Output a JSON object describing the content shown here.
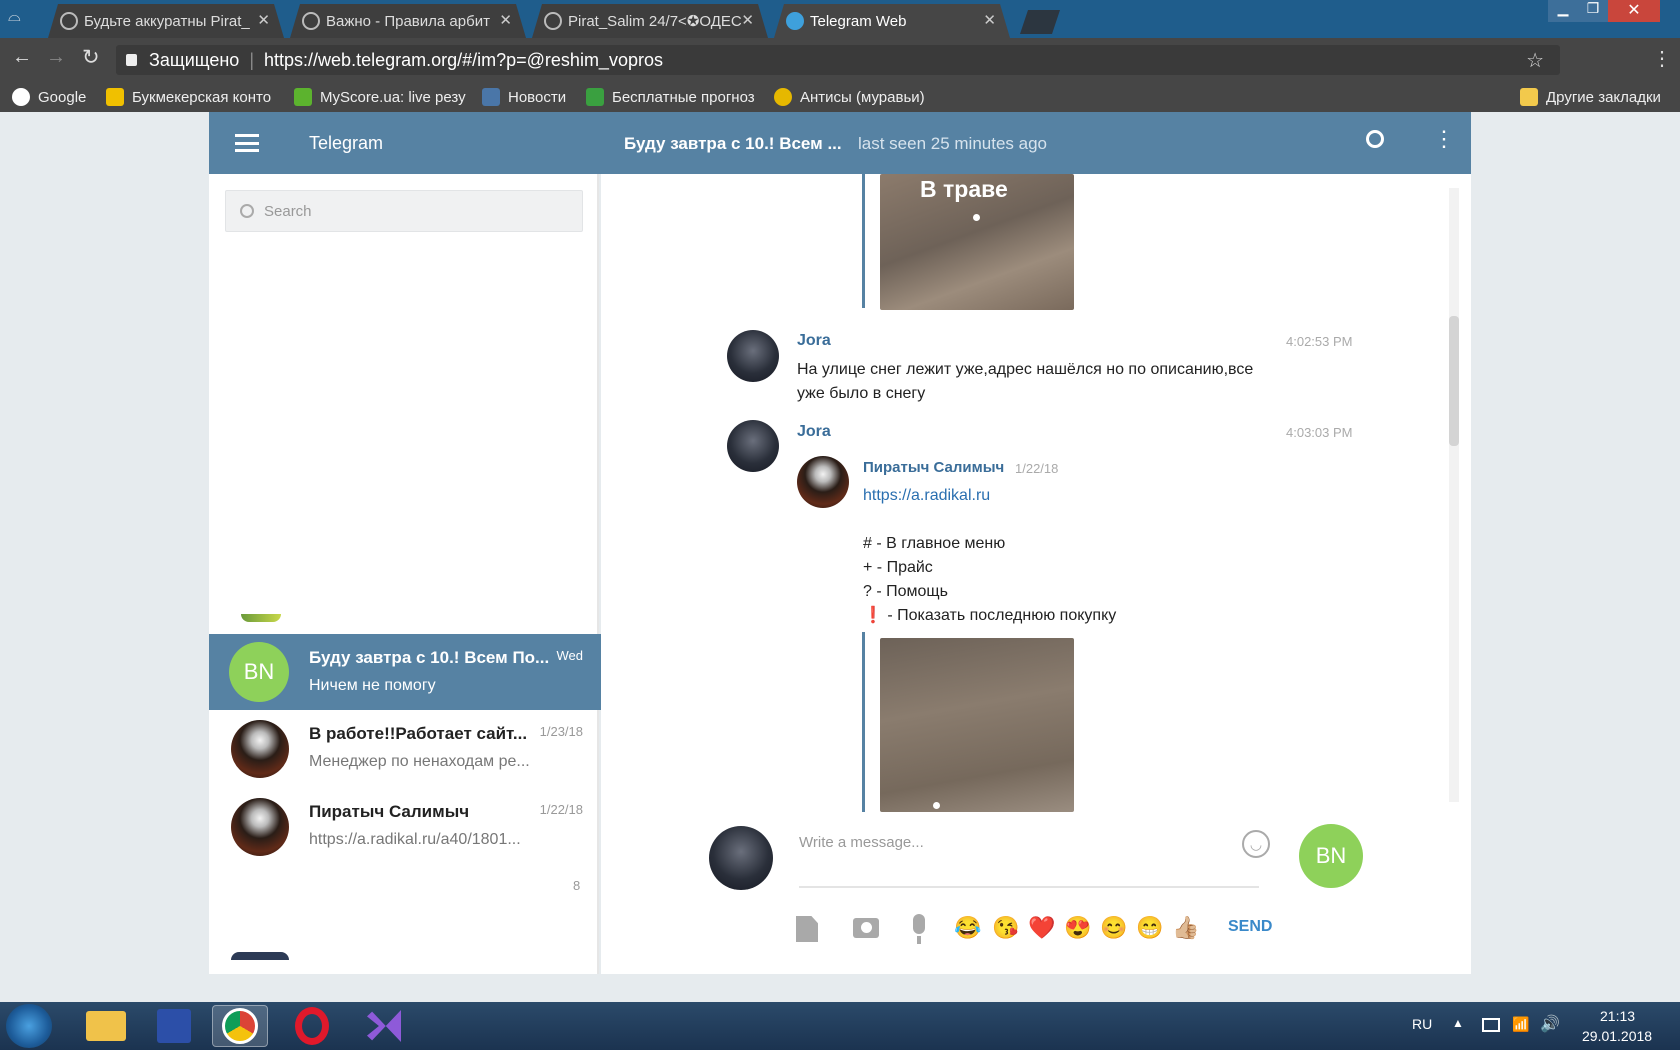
{
  "browser": {
    "tabs": [
      {
        "label": "Будьте аккуратны Pirat_"
      },
      {
        "label": "Важно - Правила арбит"
      },
      {
        "label": "Pirat_Salim 24/7<✪ОДЕС"
      },
      {
        "label": "Telegram Web"
      }
    ],
    "secure_label": "Защищено",
    "url": "https://web.telegram.org/#/im?p=@reshim_vopros",
    "bookmarks": [
      {
        "label": "Google"
      },
      {
        "label": "Букмекерская конто"
      },
      {
        "label": "MyScore.ua: live резу"
      },
      {
        "label": "Новости"
      },
      {
        "label": "Бесплатные прогноз"
      },
      {
        "label": "Антисы (муравьи)"
      }
    ],
    "other_bookmarks": "Другие закладки"
  },
  "telegram": {
    "app_title": "Telegram",
    "peer_name": "Буду завтра с 10.! Всем ...",
    "peer_status": "last seen 25 minutes ago",
    "search_placeholder": "Search",
    "dialogs": [
      {
        "name": "Буду завтра с 10.! Всем По...",
        "preview": "Ничем не помогу",
        "date": "Wed",
        "avatar": "BN"
      },
      {
        "name": "В работе!!Работает сайт...",
        "preview": "Менеджер по ненаходам ре...",
        "date": "1/23/18"
      },
      {
        "name": "Пиратыч Салимыч",
        "preview": "https://a.radikal.ru/a40/1801...",
        "date": "1/22/18"
      }
    ],
    "unread_count": "8",
    "photo_caption": "В траве",
    "messages": [
      {
        "author": "Jora",
        "time": "4:02:53 PM",
        "text": "На улице снег лежит уже,адрес нашёлся но по описанию,все уже было в снегу"
      },
      {
        "author": "Jora",
        "time": "4:03:03 PM"
      }
    ],
    "forward": {
      "author": "Пиратыч Салимыч",
      "date": "1/22/18",
      "link": "https://a.radikal.ru",
      "lines": [
        "# - В главное меню",
        "+ - Прайс",
        "? - Помощь",
        "❗ - Показать последнюю покупку"
      ]
    },
    "composer": {
      "placeholder": "Write a message...",
      "send_label": "SEND",
      "avatar": "BN",
      "emojis": [
        "😂",
        "😘",
        "❤️",
        "😍",
        "😊",
        "😁",
        "👍🏼"
      ]
    }
  },
  "taskbar": {
    "lang": "RU",
    "time": "21:13",
    "date": "29.01.2018"
  }
}
